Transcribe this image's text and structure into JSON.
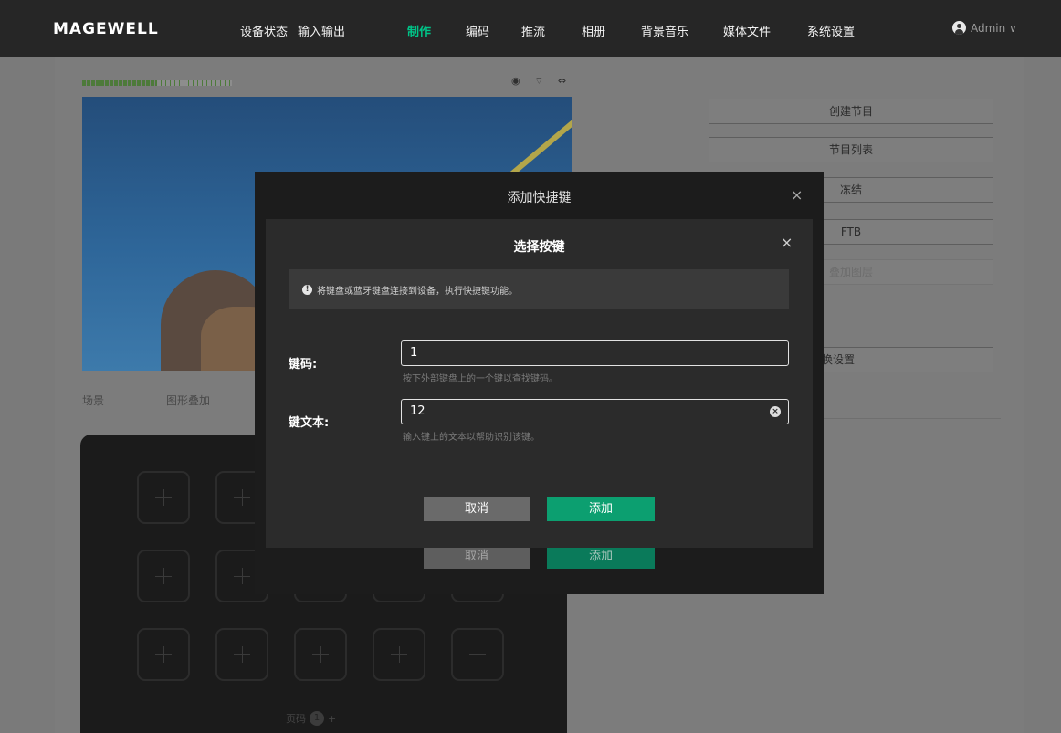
{
  "brand": "MAGEWELL",
  "nav": {
    "items": [
      {
        "label": "设备状态",
        "active": false
      },
      {
        "label": "输入输出",
        "active": false
      },
      {
        "label": "制作",
        "active": true
      },
      {
        "label": "编码",
        "active": false
      },
      {
        "label": "推流",
        "active": false
      },
      {
        "label": "相册",
        "active": false
      },
      {
        "label": "背景音乐",
        "active": false
      },
      {
        "label": "媒体文件",
        "active": false
      },
      {
        "label": "系统设置",
        "active": false
      }
    ],
    "user": "Admin ∨",
    "active_color": "#00c488"
  },
  "status_icons": "◉ ⌔ ⇔",
  "side_buttons": [
    "创建节目",
    "节目列表",
    "冻结",
    "FTB",
    "叠加图层",
    "切换设置"
  ],
  "tabs": [
    "场景",
    "图形叠加"
  ],
  "pad": {
    "page_label": "页码",
    "current_page": "1",
    "add_page": "+"
  },
  "outer_dialog": {
    "title": "添加快捷键",
    "close": "×",
    "cancel": "取消",
    "add": "添加"
  },
  "inner_dialog": {
    "title": "选择按键",
    "close": "×",
    "notice": "将键盘或蓝牙键盘连接到设备，执行快捷键功能。",
    "notice_icon": "!",
    "keycode": {
      "label": "键码:",
      "value": "1",
      "help": "按下外部键盘上的一个键以查找键码。"
    },
    "keytext": {
      "label": "键文本:",
      "value": "12",
      "help": "输入键上的文本以帮助识别该键。",
      "clear_icon": "×"
    },
    "cancel": "取消",
    "add": "添加"
  }
}
